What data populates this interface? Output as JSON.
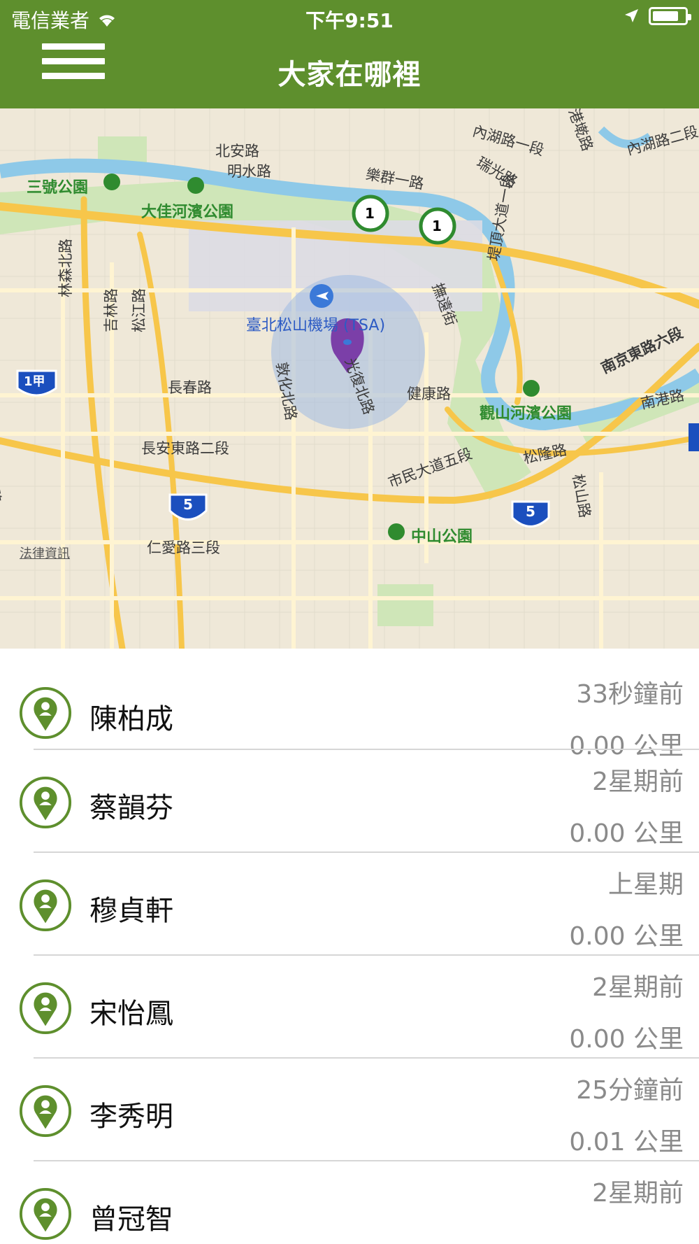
{
  "status_bar": {
    "carrier": "電信業者",
    "time": "下午9:51"
  },
  "header": {
    "title": "大家在哪裡",
    "menu_icon": "hamburger-menu-icon"
  },
  "colors": {
    "header_bg": "#5e8f2d",
    "accent_green": "#5e8f2d",
    "pin_purple": "#7b3fa8",
    "secondary_text": "#8a8a8a"
  },
  "map": {
    "labels": {
      "l1": "內湖路一段",
      "l2": "瑞光路",
      "l3": "港墘路",
      "l4": "內湖路二段",
      "l5": "北安路",
      "l6": "明水路",
      "l7": "樂群一路",
      "l8": "三號公園",
      "l9": "大佳河濱公園",
      "l10": "堤頂大道一段",
      "l11": "林森北路",
      "l12": "吉林路",
      "l13": "松江路",
      "l14": "撫遠街",
      "l15": "臺北松山機場 (TSA)",
      "l16": "南京東路六段",
      "l17": "敦化北路",
      "l18": "光復北路",
      "l19": "長春路",
      "l20": "健康路",
      "l21": "觀山河濱公園",
      "l22": "南港路",
      "l23": "長安東路二段",
      "l24": "市民大道五段",
      "l25": "松隆路",
      "l26": "松山路",
      "l27": "中山公園",
      "l28": "仁愛路三段",
      "l29": "南路",
      "legal": "法律資訊"
    },
    "shields": {
      "s1": "1",
      "s2": "1",
      "s3": "1甲",
      "s4": "5",
      "s5": "5"
    }
  },
  "people": [
    {
      "name": "陳柏成",
      "time": "33秒鐘前",
      "distance": "0.00 公里"
    },
    {
      "name": "蔡韻芬",
      "time": "2星期前",
      "distance": "0.00 公里"
    },
    {
      "name": "穆貞軒",
      "time": "上星期",
      "distance": "0.00 公里"
    },
    {
      "name": "宋怡鳳",
      "time": "2星期前",
      "distance": "0.00 公里"
    },
    {
      "name": "李秀明",
      "time": "25分鐘前",
      "distance": "0.01 公里"
    },
    {
      "name": "曾冠智",
      "time": "2星期前",
      "distance": ""
    }
  ]
}
